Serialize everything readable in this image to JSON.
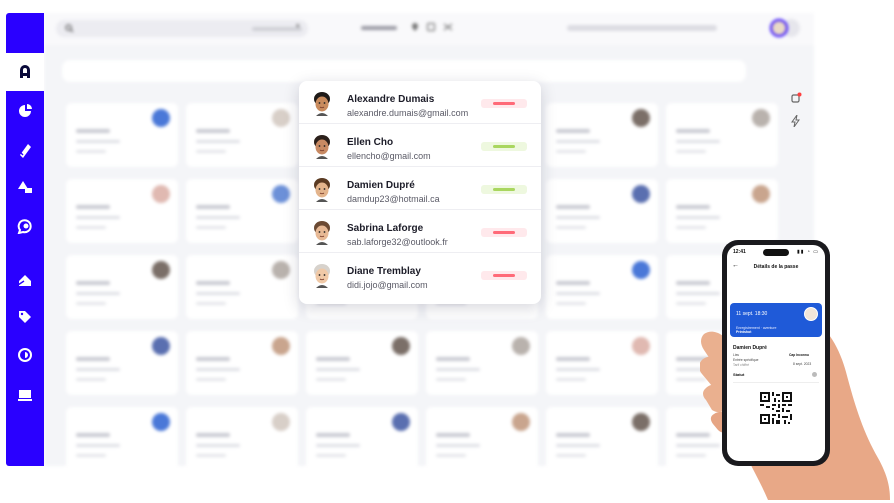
{
  "sidebar": {
    "logo_icon": "brand-logo-icon",
    "items": [
      {
        "icon": "pie-chart-icon"
      },
      {
        "icon": "ticket-icon"
      },
      {
        "icon": "shapes-icon"
      },
      {
        "icon": "speech-bubble-icon"
      },
      {
        "icon": "home-icon"
      },
      {
        "icon": "tag-icon"
      },
      {
        "icon": "target-icon"
      },
      {
        "icon": "monitor-icon"
      }
    ],
    "color": "#2a00ff"
  },
  "popup": {
    "users": [
      {
        "name": "Alexandre Dumais",
        "email": "alexandre.dumais@gmail.com",
        "status_color": "#ff6a78",
        "status_bg": "#ffe9ec",
        "skin": "#c98b5d",
        "hair": "#1e1a18"
      },
      {
        "name": "Ellen Cho",
        "email": "ellencho@gmail.com",
        "status_color": "#a9d65f",
        "status_bg": "#eef8df",
        "skin": "#c88a63",
        "hair": "#2b201b"
      },
      {
        "name": "Damien Dupré",
        "email": "damdup23@hotmail.ca",
        "status_color": "#a9d65f",
        "status_bg": "#eef8df",
        "skin": "#e3b48c",
        "hair": "#5a3a22"
      },
      {
        "name": "Sabrina Laforge",
        "email": "sab.laforge32@outlook.fr",
        "status_color": "#ff6a78",
        "status_bg": "#ffe9ec",
        "skin": "#e7b995",
        "hair": "#6b4a33"
      },
      {
        "name": "Diane Tremblay",
        "email": "didi.jojo@gmail.com",
        "status_color": "#ff6a78",
        "status_bg": "#ffe9ec",
        "skin": "#f0c9a7",
        "hair": "#d7d2cc"
      }
    ]
  },
  "phone": {
    "time": "12:41",
    "title": "Détails de la passe",
    "date": "11 sept. 18:30",
    "event_line1": "Enregistrement · aventure",
    "event_line2": "Printshot",
    "holder_name": "Damien Dupré",
    "label_left": "Lieu",
    "label_right": "Cap Inconnu",
    "value_left": "Entrée spécifique",
    "value_right": "8 sept. 2023",
    "sub_left": "Tarif chiffré",
    "statut_label": "Statut"
  },
  "colors": {
    "accent": "#2a00ff",
    "phone_card": "#1f5ad8"
  }
}
